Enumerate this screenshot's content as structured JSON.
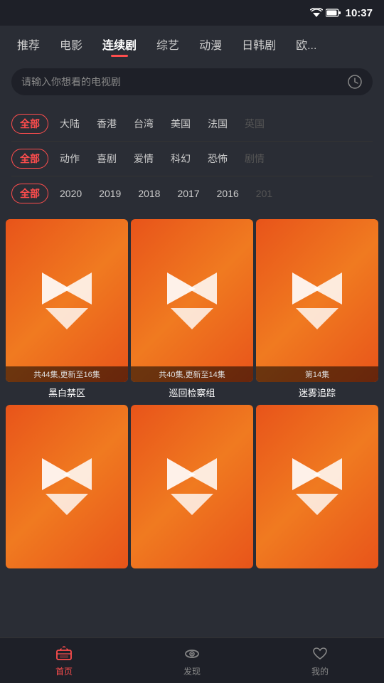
{
  "statusBar": {
    "time": "10:37"
  },
  "navTabs": {
    "items": [
      {
        "label": "推荐",
        "active": false
      },
      {
        "label": "电影",
        "active": false
      },
      {
        "label": "连续剧",
        "active": true
      },
      {
        "label": "综艺",
        "active": false
      },
      {
        "label": "动漫",
        "active": false
      },
      {
        "label": "日韩剧",
        "active": false
      },
      {
        "label": "欧...",
        "active": false
      }
    ]
  },
  "searchBar": {
    "placeholder": "请输入你想看的电视剧"
  },
  "filters": {
    "region": {
      "items": [
        "全部",
        "大陆",
        "香港",
        "台湾",
        "美国",
        "法国",
        "英国"
      ],
      "selected": 0,
      "faded": [
        6
      ]
    },
    "genre": {
      "items": [
        "全部",
        "动作",
        "喜剧",
        "爱情",
        "科幻",
        "恐怖",
        "剧情"
      ],
      "selected": 0,
      "faded": [
        6
      ]
    },
    "year": {
      "items": [
        "全部",
        "2020",
        "2019",
        "2018",
        "2017",
        "2016",
        "201"
      ],
      "selected": 0,
      "faded": [
        6
      ]
    }
  },
  "contentItems": [
    {
      "title": "黑白禁区",
      "badge": "共44集,更新至16集",
      "hasBadge": true
    },
    {
      "title": "巡回检察组",
      "badge": "共40集,更新至14集",
      "hasBadge": true
    },
    {
      "title": "迷雾追踪",
      "badge": "第14集",
      "hasBadge": true
    },
    {
      "title": "",
      "badge": "",
      "hasBadge": false
    },
    {
      "title": "",
      "badge": "",
      "hasBadge": false
    },
    {
      "title": "",
      "badge": "",
      "hasBadge": false
    }
  ],
  "bottomNav": {
    "items": [
      {
        "label": "首页",
        "active": true,
        "icon": "home-tv-icon"
      },
      {
        "label": "发现",
        "active": false,
        "icon": "discover-eye-icon"
      },
      {
        "label": "我的",
        "active": false,
        "icon": "profile-heart-icon"
      }
    ]
  }
}
